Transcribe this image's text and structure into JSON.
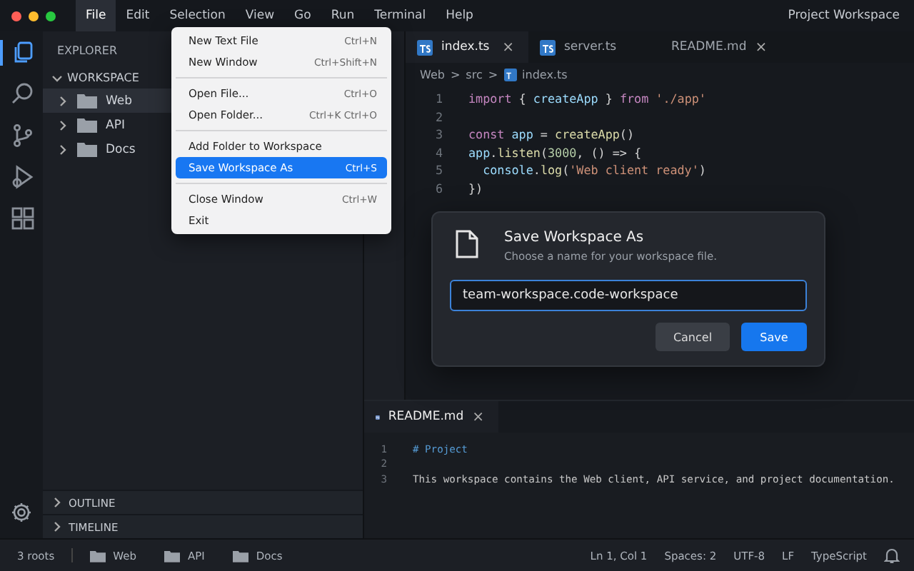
{
  "window": {
    "title": "Project Workspace"
  },
  "menu_bar": [
    {
      "label": "File",
      "selected": true
    },
    {
      "label": "Edit",
      "selected": false
    },
    {
      "label": "Selection",
      "selected": false
    },
    {
      "label": "View",
      "selected": false
    },
    {
      "label": "Go",
      "selected": false
    },
    {
      "label": "Run",
      "selected": false
    },
    {
      "label": "Terminal",
      "selected": false
    },
    {
      "label": "Help",
      "selected": false
    }
  ],
  "file_menu": [
    [
      {
        "label": "New Text File",
        "shortcut": "Ctrl+N",
        "selected": false
      },
      {
        "label": "New Window",
        "shortcut": "Ctrl+Shift+N",
        "selected": false
      }
    ],
    [
      {
        "label": "Open File...",
        "shortcut": "Ctrl+O",
        "selected": false
      },
      {
        "label": "Open Folder...",
        "shortcut": "Ctrl+K Ctrl+O",
        "selected": false
      }
    ],
    [
      {
        "label": "Add Folder to Workspace",
        "selected": false
      },
      {
        "label": "Save Workspace As",
        "shortcut": "Ctrl+S",
        "selected": true
      }
    ],
    [
      {
        "label": "Close Window",
        "shortcut": "Ctrl+W",
        "selected": false
      },
      {
        "label": "Exit",
        "selected": false
      }
    ]
  ],
  "activity_bar": [
    {
      "kind": "files",
      "selected": true
    },
    {
      "kind": "search",
      "selected": false
    },
    {
      "kind": "source",
      "selected": false
    },
    {
      "kind": "run",
      "selected": false
    },
    {
      "kind": "extensions",
      "selected": false
    }
  ],
  "sidebar": {
    "title": "EXPLORER",
    "section": "WORKSPACE",
    "items": [
      {
        "label": "Web",
        "selected": true
      },
      {
        "label": "API",
        "selected": false
      },
      {
        "label": "Docs",
        "selected": false
      }
    ],
    "panels": [
      "OUTLINE",
      "TIMELINE"
    ]
  },
  "editor_tabs": [
    {
      "kind": "typescript",
      "label": "index.ts",
      "close": "×",
      "selected": true
    },
    {
      "kind": "typescript",
      "label": "server.ts",
      "selected": false
    },
    {
      "kind": "markdown",
      "label": "README.md",
      "close": "×",
      "selected": false
    }
  ],
  "breadcrumb": {
    "parts": [
      "Web",
      ">",
      "src",
      ">"
    ],
    "file": "index.ts"
  },
  "code": [
    {
      "number": "1",
      "tokens": [
        {
          "text": "import",
          "kind": "keyword"
        },
        {
          "text": " { ",
          "kind": "plain"
        },
        {
          "text": "createApp",
          "kind": "name"
        },
        {
          "text": " } ",
          "kind": "plain"
        },
        {
          "text": "from",
          "kind": "keyword"
        },
        {
          "text": " './app'",
          "kind": "string"
        }
      ]
    },
    {
      "number": "2"
    },
    {
      "number": "3",
      "tokens": [
        {
          "text": "const",
          "kind": "keyword"
        },
        {
          "text": " app",
          "kind": "name"
        },
        {
          "text": " = ",
          "kind": "plain"
        },
        {
          "text": "createApp",
          "kind": "func"
        },
        {
          "text": "()",
          "kind": "plain"
        }
      ]
    },
    {
      "number": "4",
      "tokens": [
        {
          "text": "app",
          "kind": "name"
        },
        {
          "text": ".",
          "kind": "plain"
        },
        {
          "text": "listen",
          "kind": "func"
        },
        {
          "text": "(",
          "kind": "plain"
        },
        {
          "text": "3000",
          "kind": "number"
        },
        {
          "text": ", () => {",
          "kind": "plain"
        }
      ]
    },
    {
      "number": "5",
      "tokens": [
        {
          "text": "  console",
          "kind": "name"
        },
        {
          "text": ".",
          "kind": "plain"
        },
        {
          "text": "log",
          "kind": "func"
        },
        {
          "text": "(",
          "kind": "plain"
        },
        {
          "text": "'Web client ready'",
          "kind": "string"
        },
        {
          "text": ")",
          "kind": "plain"
        }
      ]
    },
    {
      "number": "6",
      "tokens": [
        {
          "text": "})",
          "kind": "plain"
        }
      ]
    }
  ],
  "dialog": {
    "title": "Save Workspace As",
    "subtitle": "Choose a name for your workspace file.",
    "value": "team-workspace.code-workspace",
    "buttons": [
      {
        "label": "Cancel",
        "kind": "secondary"
      },
      {
        "label": "Save",
        "kind": "primary"
      }
    ]
  },
  "bottom_editor": {
    "tab": {
      "label": "README.md",
      "close": "×"
    },
    "lines": [
      {
        "number": "1",
        "text": "# Project",
        "kind": "heading"
      },
      {
        "number": "2"
      },
      {
        "number": "3",
        "text": "This workspace contains the Web client, API service, and project documentation.",
        "kind": "plain"
      }
    ]
  },
  "status_bar": {
    "roots": "3 roots",
    "folders": [
      "Web",
      "API",
      "Docs"
    ],
    "right": [
      "Ln 1, Col 1",
      "Spaces: 2",
      "UTF-8",
      "LF",
      "TypeScript"
    ]
  }
}
